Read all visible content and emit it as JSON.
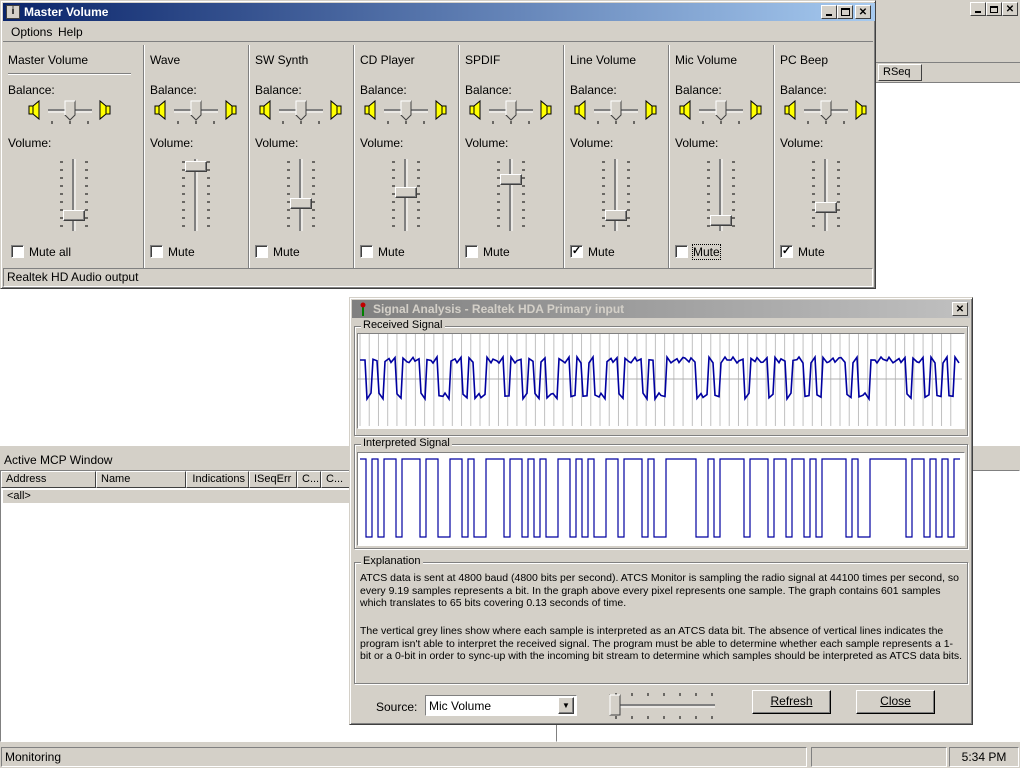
{
  "master": {
    "title": "Master Volume",
    "menu": [
      "Options",
      "Help"
    ],
    "channels": [
      {
        "name": "Master Volume",
        "mute_label": "Mute all",
        "muted": false,
        "volume": 0.14
      },
      {
        "name": "Wave",
        "mute_label": "Mute",
        "muted": false,
        "volume": 0.95
      },
      {
        "name": "SW Synth",
        "mute_label": "Mute",
        "muted": false,
        "volume": 0.33
      },
      {
        "name": "CD Player",
        "mute_label": "Mute",
        "muted": false,
        "volume": 0.52
      },
      {
        "name": "SPDIF",
        "mute_label": "Mute",
        "muted": false,
        "volume": 0.73
      },
      {
        "name": "Line Volume",
        "mute_label": "Mute",
        "muted": true,
        "volume": 0.14
      },
      {
        "name": "Mic Volume",
        "mute_label": "Mute",
        "muted": false,
        "volume": 0.05
      },
      {
        "name": "PC Beep",
        "mute_label": "Mute",
        "muted": true,
        "volume": 0.26
      }
    ],
    "balance_label": "Balance:",
    "volume_label": "Volume:",
    "status": "Realtek HD Audio output"
  },
  "bg": {
    "rseq_header": "RSeq",
    "mcp_title": "Active MCP Window",
    "columns": [
      "Address",
      "Name",
      "Indications",
      "ISeqErr",
      "C...",
      "C..."
    ],
    "rows": [
      "<all>"
    ],
    "status": "Monitoring",
    "clock": "5:34 PM"
  },
  "signal": {
    "title": "Signal Analysis - Realtek HDA Primary input",
    "received_label": "Received Signal",
    "interpreted_label": "Interpreted Signal",
    "explanation_label": "Explanation",
    "explanation_p1": "ATCS data is sent at 4800 baud (4800 bits per second).  ATCS Monitor is sampling the radio signal at 44100 times per second, so every 9.19 samples represents a bit.  In the graph above every pixel represents one sample.  The graph contains 601 samples which translates to 65 bits covering 0.13 seconds of time.",
    "explanation_p2": "The vertical grey lines show where each sample is interpreted as an ATCS data bit.  The absence of vertical lines indicates the program isn't able to interpret the received signal.  The program must be able to determine whether each sample represents a 1-bit or a 0-bit in order to sync-up with the incoming bit stream to determine which samples should be interpreted as ATCS data bits.",
    "source_label": "Source:",
    "source_value": "Mic Volume",
    "refresh_label": "Refresh",
    "close_label": "Close",
    "bits": "1010110111011001101001110110101001101010011011101001111100101111011101101101011110100111111011010101",
    "colors": {
      "signal": "#0000a0",
      "titlebar_inactive": "#808080"
    }
  }
}
